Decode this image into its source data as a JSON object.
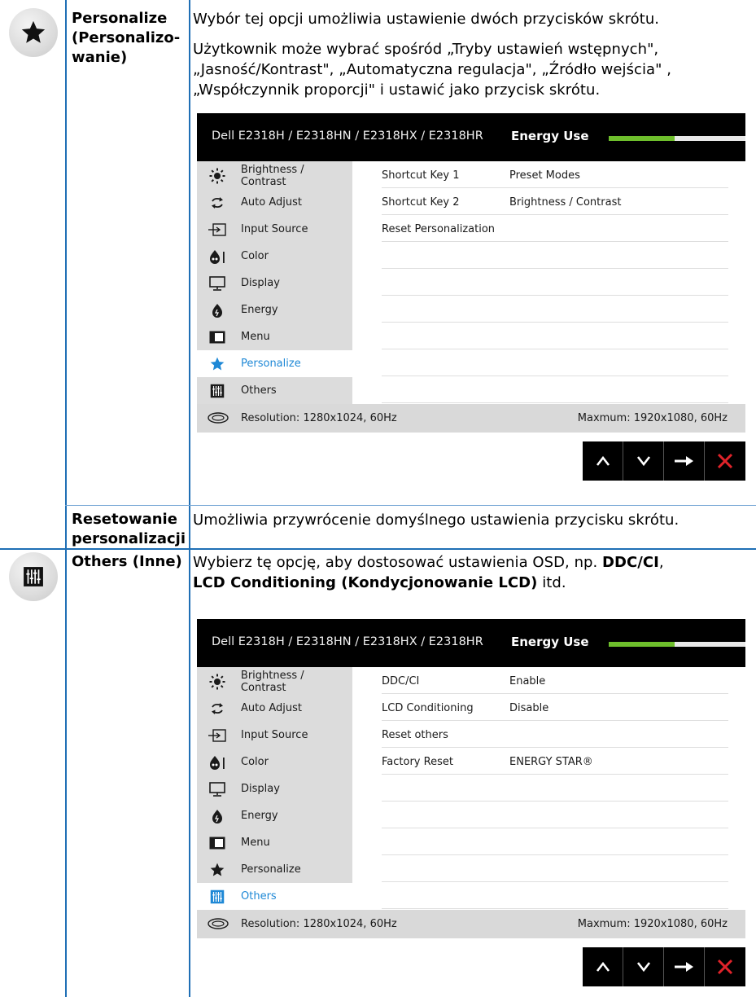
{
  "sections": [
    {
      "label_lines": [
        "Personalize",
        "(Personalizo-",
        "wanie)"
      ],
      "icon": "star-icon",
      "desc_lines": [
        "Wybór tej opcji umożliwia ustawienie dwóch przycisków skrótu.",
        "Użytkownik może wybrać spośród „Tryby ustawień wstępnych\",",
        "„Jasność/Kontrast\", „Automatyczna regulacja\", „Źródło wejścia\" ,",
        "„Współczynnik proporcji\" i ustawić jako przycisk skrótu."
      ]
    },
    {
      "label_lines": [
        "Resetowanie",
        "personalizacji"
      ],
      "desc": "Umożliwia przywrócenie domyślnego ustawienia przycisku skrótu."
    },
    {
      "label_lines": [
        "Others (Inne)"
      ],
      "icon": "others-icon",
      "desc_p1": "Wybierz tę opcję, aby dostosować ustawienia OSD, np. ",
      "desc_b1": "DDC/CI",
      "desc_p2": ",",
      "desc_b2": "LCD Conditioning (Kondycjonowanie LCD)",
      "desc_p3": " itd."
    }
  ],
  "osd_common": {
    "model": "Dell E2318H / E2318HN / E2318HX / E2318HR",
    "energy_label": "Energy Use",
    "energy_level": 0.48,
    "menu": [
      {
        "label": "Brightness / Contrast",
        "icon": "brightness-icon"
      },
      {
        "label": "Auto Adjust",
        "icon": "auto-adjust-icon"
      },
      {
        "label": "Input Source",
        "icon": "input-source-icon"
      },
      {
        "label": "Color",
        "icon": "color-icon"
      },
      {
        "label": "Display",
        "icon": "display-icon"
      },
      {
        "label": "Energy",
        "icon": "energy-icon"
      },
      {
        "label": "Menu",
        "icon": "menu-icon"
      },
      {
        "label": "Personalize",
        "icon": "star-icon"
      },
      {
        "label": "Others",
        "icon": "others-icon"
      }
    ],
    "resolution": "Resolution: 1280x1024, 60Hz",
    "maximum": "Maxmum: 1920x1080, 60Hz",
    "nav": [
      "up-button",
      "down-button",
      "enter-button",
      "exit-button"
    ]
  },
  "osd1": {
    "active_index": 7,
    "rows": [
      {
        "k": "Shortcut Key 1",
        "v": "Preset Modes"
      },
      {
        "k": "Shortcut Key 2",
        "v": "Brightness / Contrast"
      },
      {
        "k": "Reset Personalization",
        "v": ""
      },
      {
        "k": "",
        "v": ""
      },
      {
        "k": "",
        "v": ""
      },
      {
        "k": "",
        "v": ""
      },
      {
        "k": "",
        "v": ""
      },
      {
        "k": "",
        "v": ""
      },
      {
        "k": "",
        "v": ""
      }
    ]
  },
  "osd2": {
    "active_index": 8,
    "rows": [
      {
        "k": "DDC/CI",
        "v": "Enable"
      },
      {
        "k": "LCD Conditioning",
        "v": "Disable"
      },
      {
        "k": "Reset others",
        "v": ""
      },
      {
        "k": "Factory Reset",
        "v": "ENERGY STAR®"
      },
      {
        "k": "",
        "v": ""
      },
      {
        "k": "",
        "v": ""
      },
      {
        "k": "",
        "v": ""
      },
      {
        "k": "",
        "v": ""
      },
      {
        "k": "",
        "v": ""
      }
    ]
  },
  "colors": {
    "rule": "#1f6fb5",
    "accent": "#1e88d6",
    "energy_fill": "#6ebe2c",
    "exit": "#e0232a"
  }
}
